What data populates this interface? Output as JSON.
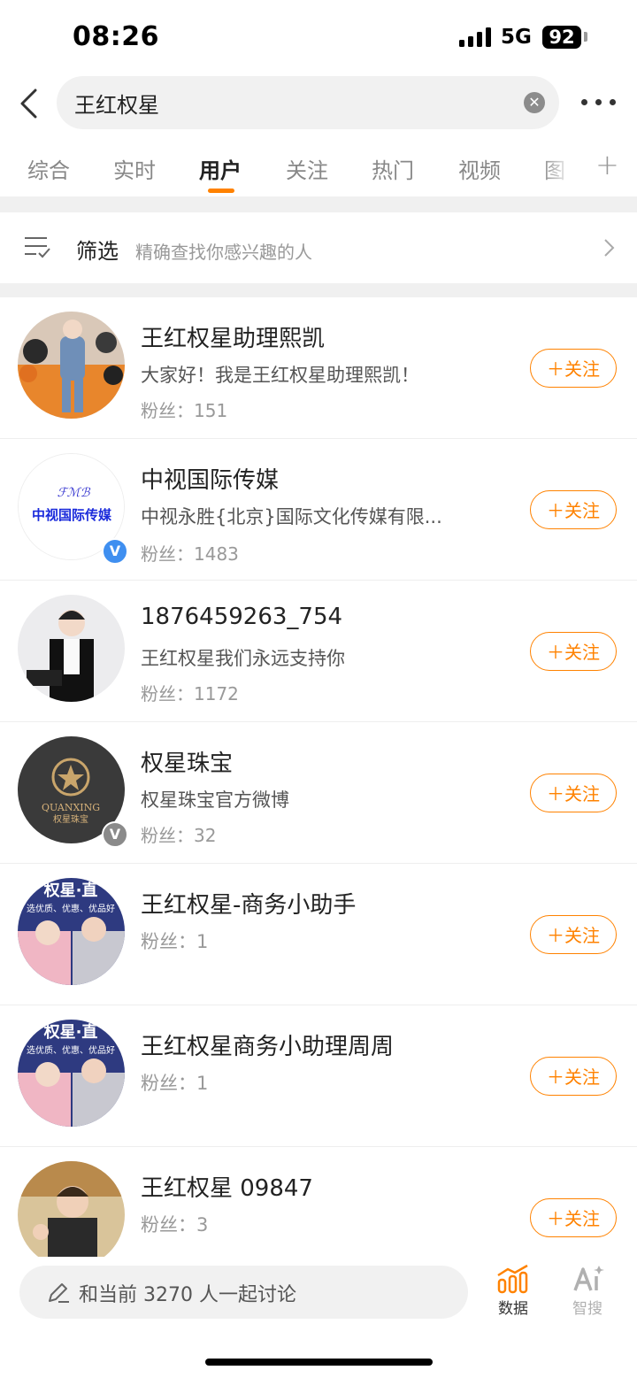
{
  "status_bar": {
    "time": "08:26",
    "network": "5G",
    "battery": "92"
  },
  "header": {
    "search_query": "王红权星"
  },
  "tabs": [
    {
      "label": "综合",
      "active": false
    },
    {
      "label": "实时",
      "active": false
    },
    {
      "label": "用户",
      "active": true
    },
    {
      "label": "关注",
      "active": false
    },
    {
      "label": "热门",
      "active": false
    },
    {
      "label": "视频",
      "active": false
    },
    {
      "label": "图",
      "active": false
    }
  ],
  "filter": {
    "title": "筛选",
    "subtitle": "精确查找你感兴趣的人"
  },
  "users": [
    {
      "name": "王红权星助理熙凯",
      "desc": "大家好！我是王红权星助理熙凯！",
      "fans": "粉丝：151",
      "follow": "＋关注"
    },
    {
      "name": "中视国际传媒",
      "desc": "中视永胜{北京}国际文化传媒有限...",
      "fans": "粉丝：1483",
      "follow": "＋关注",
      "avatar_text": "中视国际传媒",
      "verified": "blue"
    },
    {
      "name": "1876459263_754",
      "desc": "王红权星我们永远支持你",
      "fans": "粉丝：1172",
      "follow": "＋关注"
    },
    {
      "name": "权星珠宝",
      "desc": "权星珠宝官方微博",
      "fans": "粉丝：32",
      "follow": "＋关注",
      "avatar_text": "QUANXING",
      "avatar_text2": "权星珠宝",
      "verified": "gray"
    },
    {
      "name": "王红权星-商务小助手",
      "fans": "粉丝：1",
      "follow": "＋关注",
      "avatar_text": "权星·直",
      "avatar_text2": "选优质、优惠、优品好"
    },
    {
      "name": "王红权星商务小助理周周",
      "fans": "粉丝：1",
      "follow": "＋关注",
      "avatar_text": "权星·直",
      "avatar_text2": "选优质、优惠、优品好"
    },
    {
      "name": "王红权星 09847",
      "fans": "粉丝：3",
      "follow": "＋关注"
    }
  ],
  "bottom": {
    "discuss_placeholder": "和当前 3270 人一起讨论",
    "nav": [
      {
        "label": "数据",
        "icon": "data-chart-icon",
        "color": "#ff8200"
      },
      {
        "label": "智搜",
        "icon": "ai-search-icon",
        "color": "#b0b0b0"
      }
    ]
  },
  "colors": {
    "accent": "#ff8200",
    "verified_blue": "#3f8ff0",
    "verified_gray": "#8a8a8a"
  }
}
